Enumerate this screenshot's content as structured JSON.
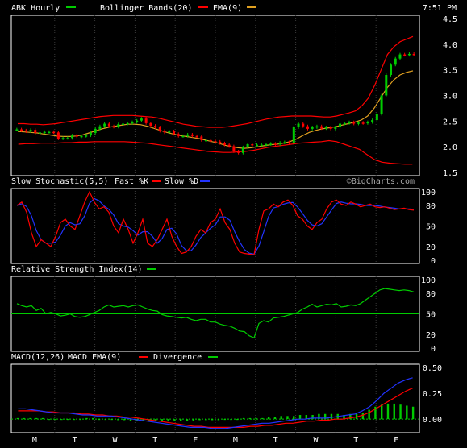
{
  "time_label": "7:51 PM",
  "colors": {
    "background": "#000000",
    "frame": "#ffffff",
    "grid": "#3a3a3a",
    "green": "#00cc00",
    "red": "#ff0000",
    "blue": "#2233ff",
    "orange": "#e0a020",
    "white": "#ffffff"
  },
  "chart_data": [
    {
      "type": "candlestick",
      "panel": "price",
      "legend": [
        {
          "name": "ABK Hourly",
          "color": "#00cc00"
        },
        {
          "name": "Bollinger Bands(20)",
          "color": "#ff0000"
        },
        {
          "name": "EMA(9)",
          "color": "#e0a020"
        }
      ],
      "ylim": [
        1.5,
        4.5
      ],
      "yticks": [
        "1.5",
        "2.0",
        "2.5",
        "3.0",
        "3.5",
        "4.0",
        "4.5"
      ],
      "x_labels": [
        "M",
        "T",
        "W",
        "T",
        "F",
        "M",
        "T",
        "W",
        "T",
        "F"
      ],
      "close": [
        2.34,
        2.32,
        2.3,
        2.33,
        2.27,
        2.28,
        2.29,
        2.29,
        2.28,
        2.16,
        2.17,
        2.17,
        2.22,
        2.2,
        2.21,
        2.22,
        2.27,
        2.35,
        2.4,
        2.45,
        2.4,
        2.39,
        2.44,
        2.45,
        2.46,
        2.48,
        2.51,
        2.55,
        2.46,
        2.41,
        2.38,
        2.31,
        2.28,
        2.3,
        2.25,
        2.21,
        2.21,
        2.24,
        2.21,
        2.2,
        2.13,
        2.13,
        2.11,
        2.1,
        2.07,
        2.04,
        2.01,
        1.91,
        1.88,
        1.99,
        2.05,
        2.03,
        2.04,
        2.04,
        2.05,
        2.06,
        2.05,
        2.08,
        2.09,
        2.08,
        2.38,
        2.45,
        2.4,
        2.35,
        2.38,
        2.4,
        2.36,
        2.38,
        2.35,
        2.38,
        2.45,
        2.46,
        2.48,
        2.45,
        2.47,
        2.46,
        2.48,
        2.52,
        2.64,
        3.0,
        3.4,
        3.6,
        3.72,
        3.8,
        3.79,
        3.81,
        3.8
      ],
      "bollinger_upper": [
        2.45,
        2.45,
        2.44,
        2.44,
        2.43,
        2.44,
        2.45,
        2.47,
        2.49,
        2.51,
        2.53,
        2.55,
        2.57,
        2.59,
        2.6,
        2.61,
        2.61,
        2.61,
        2.61,
        2.6,
        2.59,
        2.58,
        2.56,
        2.53,
        2.5,
        2.47,
        2.44,
        2.42,
        2.4,
        2.39,
        2.38,
        2.38,
        2.38,
        2.39,
        2.41,
        2.43,
        2.45,
        2.48,
        2.51,
        2.54,
        2.56,
        2.58,
        2.59,
        2.6,
        2.6,
        2.6,
        2.6,
        2.59,
        2.58,
        2.58,
        2.6,
        2.63,
        2.66,
        2.7,
        2.8,
        2.95,
        3.2,
        3.5,
        3.8,
        3.95,
        4.05,
        4.1,
        4.15
      ],
      "bollinger_lower": [
        2.05,
        2.06,
        2.06,
        2.07,
        2.07,
        2.07,
        2.08,
        2.08,
        2.09,
        2.09,
        2.1,
        2.1,
        2.1,
        2.1,
        2.1,
        2.09,
        2.08,
        2.07,
        2.05,
        2.03,
        2.01,
        1.99,
        1.97,
        1.95,
        1.93,
        1.91,
        1.9,
        1.89,
        1.89,
        1.9,
        1.91,
        1.93,
        1.96,
        1.99,
        2.01,
        2.03,
        2.05,
        2.07,
        2.08,
        2.09,
        2.1,
        2.12,
        2.1,
        2.05,
        2.0,
        1.95,
        1.85,
        1.75,
        1.7,
        1.68,
        1.67,
        1.66,
        1.66
      ],
      "ema9": [
        2.3,
        2.29,
        2.28,
        2.27,
        2.25,
        2.23,
        2.21,
        2.2,
        2.2,
        2.21,
        2.23,
        2.27,
        2.31,
        2.35,
        2.38,
        2.4,
        2.42,
        2.44,
        2.44,
        2.43,
        2.4,
        2.36,
        2.32,
        2.28,
        2.25,
        2.22,
        2.2,
        2.18,
        2.16,
        2.13,
        2.1,
        2.07,
        2.03,
        2.0,
        1.98,
        1.97,
        1.98,
        2.0,
        2.02,
        2.04,
        2.05,
        2.07,
        2.1,
        2.15,
        2.22,
        2.28,
        2.32,
        2.35,
        2.37,
        2.39,
        2.42,
        2.45,
        2.48,
        2.52,
        2.6,
        2.75,
        2.95,
        3.15,
        3.3,
        3.4,
        3.45,
        3.48
      ]
    },
    {
      "type": "line",
      "panel": "stochastic",
      "legend": [
        {
          "name": "Slow Stochastic(5,5)",
          "color": "#ffffff"
        },
        {
          "name": "Fast %K",
          "color": "#ff0000"
        },
        {
          "name": "Slow %D",
          "color": "#2233ff"
        }
      ],
      "watermark": "©BigCharts.com",
      "ylim": [
        0,
        100
      ],
      "yticks": [
        "0",
        "20",
        "50",
        "80",
        "100"
      ],
      "fast_k": [
        80,
        85,
        70,
        40,
        20,
        30,
        25,
        20,
        35,
        55,
        60,
        50,
        45,
        65,
        85,
        100,
        85,
        75,
        78,
        70,
        50,
        40,
        60,
        45,
        25,
        40,
        60,
        25,
        20,
        30,
        45,
        60,
        35,
        20,
        10,
        12,
        20,
        35,
        45,
        40,
        55,
        60,
        75,
        55,
        45,
        25,
        12,
        10,
        9,
        8,
        45,
        72,
        75,
        82,
        78,
        85,
        88,
        80,
        65,
        60,
        50,
        45,
        55,
        60,
        75,
        85,
        88,
        82,
        80,
        85,
        82,
        78,
        80,
        82,
        78,
        77,
        78,
        76,
        74,
        75,
        76,
        74,
        73
      ]
    },
    {
      "type": "line",
      "panel": "rsi",
      "legend": [
        {
          "name": "Relative Strength Index(14)",
          "color": "#00cc00"
        }
      ],
      "ylim": [
        0,
        100
      ],
      "yticks": [
        "0",
        "20",
        "50",
        "80",
        "100"
      ],
      "reference_line": 50,
      "values": [
        65,
        62,
        60,
        62,
        55,
        58,
        50,
        52,
        50,
        47,
        48,
        50,
        46,
        45,
        46,
        49,
        52,
        55,
        60,
        63,
        60,
        61,
        62,
        60,
        62,
        63,
        60,
        57,
        55,
        54,
        49,
        47,
        46,
        45,
        44,
        45,
        42,
        40,
        42,
        42,
        38,
        38,
        35,
        33,
        32,
        29,
        25,
        24,
        18,
        15,
        36,
        40,
        38,
        44,
        45,
        46,
        48,
        50,
        52,
        57,
        60,
        64,
        60,
        62,
        64,
        63,
        65,
        60,
        61,
        63,
        62,
        65,
        70,
        75,
        80,
        85,
        87,
        86,
        85,
        84,
        85,
        84,
        82
      ]
    },
    {
      "type": "line",
      "panel": "macd",
      "legend": [
        {
          "name": "MACD(12,26)",
          "color": "#ffffff"
        },
        {
          "name": "MACD EMA(9)",
          "color": "#2233ff"
        },
        {
          "name": "Divergence",
          "color": "#00cc00"
        }
      ],
      "ylim": [
        -0.1,
        0.5
      ],
      "yticks": [
        "0.00",
        "0.25",
        "0.50"
      ],
      "macd_ema": [
        0.1,
        0.1,
        0.09,
        0.08,
        0.07,
        0.06,
        0.06,
        0.06,
        0.05,
        0.04,
        0.04,
        0.03,
        0.03,
        0.03,
        0.02,
        0.01,
        0.0,
        -0.01,
        -0.02,
        -0.03,
        -0.04,
        -0.05,
        -0.06,
        -0.07,
        -0.08,
        -0.08,
        -0.08,
        -0.09,
        -0.09,
        -0.09,
        -0.08,
        -0.07,
        -0.06,
        -0.05,
        -0.04,
        -0.04,
        -0.03,
        -0.02,
        -0.01,
        0.0,
        0.0,
        0.01,
        0.01,
        0.01,
        0.02,
        0.03,
        0.04,
        0.05,
        0.08,
        0.12,
        0.18,
        0.25,
        0.3,
        0.35,
        0.38,
        0.4
      ],
      "macd_signal": [
        0.08,
        0.08,
        0.08,
        0.08,
        0.07,
        0.07,
        0.06,
        0.06,
        0.06,
        0.05,
        0.05,
        0.04,
        0.04,
        0.03,
        0.03,
        0.02,
        0.02,
        0.01,
        0.0,
        -0.01,
        -0.02,
        -0.03,
        -0.04,
        -0.05,
        -0.06,
        -0.07,
        -0.07,
        -0.08,
        -0.08,
        -0.08,
        -0.08,
        -0.08,
        -0.08,
        -0.07,
        -0.07,
        -0.06,
        -0.06,
        -0.05,
        -0.04,
        -0.04,
        -0.03,
        -0.02,
        -0.02,
        -0.01,
        -0.01,
        0.0,
        0.0,
        0.01,
        0.02,
        0.04,
        0.07,
        0.11,
        0.15,
        0.19,
        0.23,
        0.27,
        0.3
      ],
      "divergence": [
        0.01,
        0.01,
        0.01,
        0.01,
        0.01,
        0.0,
        0.0,
        0.0,
        0.0,
        0.0,
        0.0,
        0.01,
        0.01,
        0.0,
        0.0,
        0.0,
        -0.01,
        -0.01,
        -0.02,
        -0.02,
        -0.02,
        -0.02,
        -0.02,
        -0.02,
        -0.02,
        -0.02,
        -0.02,
        -0.02,
        -0.02,
        -0.01,
        -0.01,
        -0.01,
        -0.01,
        0.0,
        0.0,
        0.0,
        0.01,
        0.01,
        0.01,
        0.01,
        0.02,
        0.02,
        0.03,
        0.03,
        0.03,
        0.04,
        0.04,
        0.04,
        0.05,
        0.05,
        0.05,
        0.05,
        0.04,
        0.05,
        0.05,
        0.06,
        0.09,
        0.12,
        0.14,
        0.15,
        0.15,
        0.14,
        0.13,
        0.12
      ]
    }
  ]
}
